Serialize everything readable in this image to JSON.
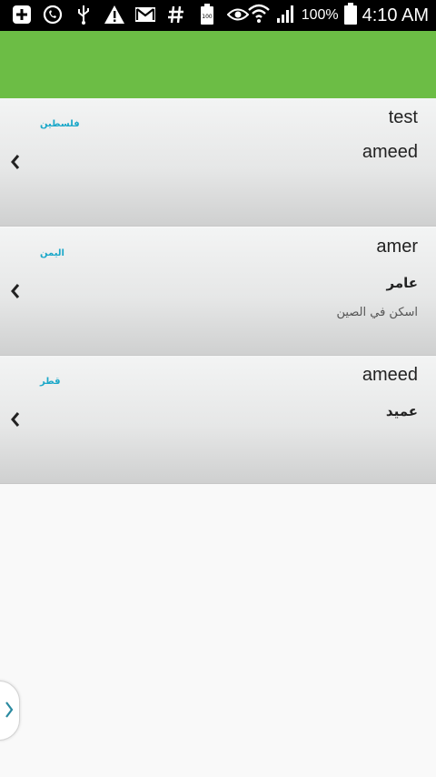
{
  "status_bar": {
    "icons": [
      "add-box-icon",
      "whatsapp-icon",
      "usb-icon",
      "warning-icon",
      "gmail-icon",
      "hash-icon",
      "battery-100-icon",
      "eye-icon",
      "wifi-icon",
      "signal-icon"
    ],
    "battery_badge": "100",
    "battery_percent": "100%",
    "time": "4:10 AM"
  },
  "colors": {
    "app_bar": "#6cbd45",
    "country_text": "#1ca8c9"
  },
  "items": [
    {
      "name": "test",
      "country": "فلسطين",
      "subname": "ameed",
      "description": ""
    },
    {
      "name": "amer",
      "country": "اليمن",
      "subname": "عامر",
      "description": "اسكن في الصين"
    },
    {
      "name": "ameed",
      "country": "قطر",
      "subname": "عميد",
      "description": ""
    }
  ]
}
